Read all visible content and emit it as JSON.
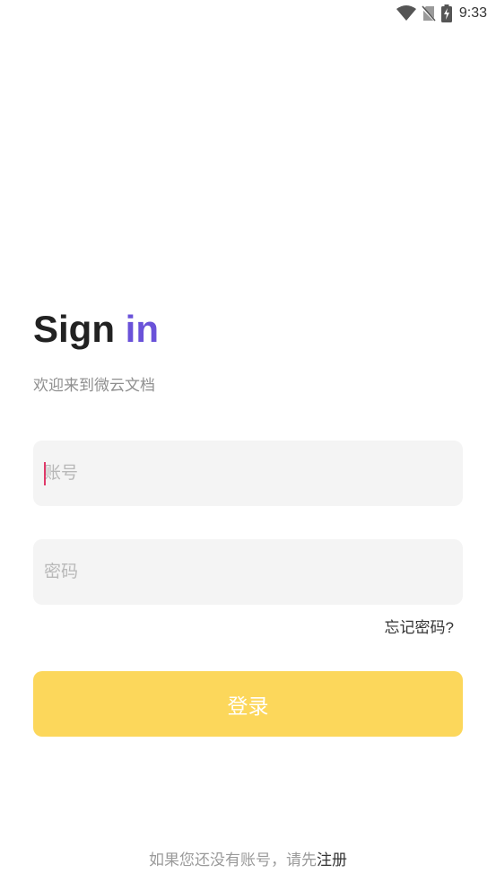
{
  "status_bar": {
    "time": "9:33",
    "icons": [
      "wifi-icon",
      "no-sim-icon",
      "battery-charging-icon"
    ]
  },
  "title": {
    "part1": "Sign",
    "part2": "in",
    "accent_color": "#6a52d9"
  },
  "subtitle": "欢迎来到微云文档",
  "account_field": {
    "placeholder": "账号",
    "value": ""
  },
  "password_field": {
    "placeholder": "密码",
    "value": ""
  },
  "forgot_password": "忘记密码?",
  "login_button": {
    "label": "登录",
    "color": "#fcd75b"
  },
  "footer": {
    "prompt": "如果您还没有账号，请先",
    "register_label": "注册"
  }
}
